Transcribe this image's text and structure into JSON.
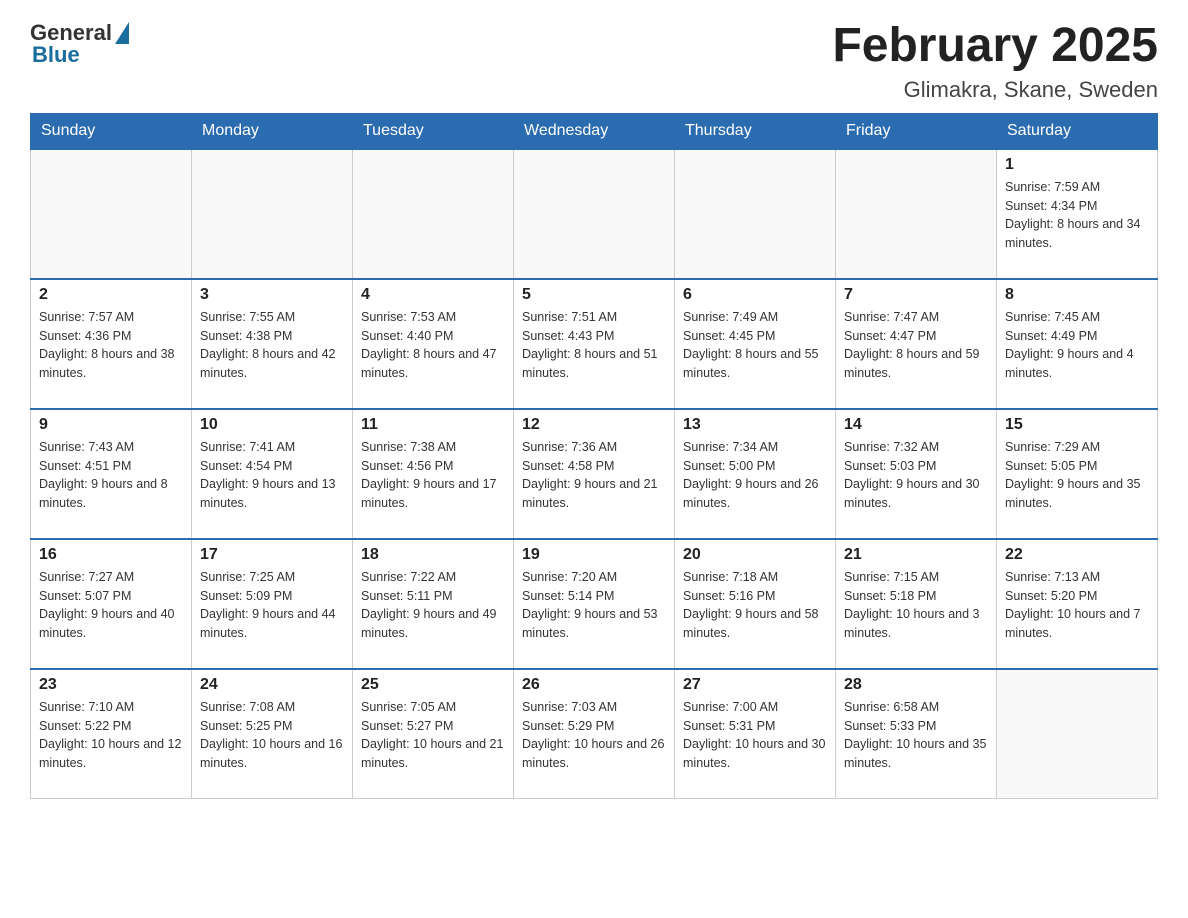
{
  "header": {
    "logo": {
      "general": "General",
      "blue": "Blue"
    },
    "title": "February 2025",
    "location": "Glimakra, Skane, Sweden"
  },
  "days_of_week": [
    "Sunday",
    "Monday",
    "Tuesday",
    "Wednesday",
    "Thursday",
    "Friday",
    "Saturday"
  ],
  "weeks": [
    [
      {
        "day": "",
        "sunrise": "",
        "sunset": "",
        "daylight": ""
      },
      {
        "day": "",
        "sunrise": "",
        "sunset": "",
        "daylight": ""
      },
      {
        "day": "",
        "sunrise": "",
        "sunset": "",
        "daylight": ""
      },
      {
        "day": "",
        "sunrise": "",
        "sunset": "",
        "daylight": ""
      },
      {
        "day": "",
        "sunrise": "",
        "sunset": "",
        "daylight": ""
      },
      {
        "day": "",
        "sunrise": "",
        "sunset": "",
        "daylight": ""
      },
      {
        "day": "1",
        "sunrise": "Sunrise: 7:59 AM",
        "sunset": "Sunset: 4:34 PM",
        "daylight": "Daylight: 8 hours and 34 minutes."
      }
    ],
    [
      {
        "day": "2",
        "sunrise": "Sunrise: 7:57 AM",
        "sunset": "Sunset: 4:36 PM",
        "daylight": "Daylight: 8 hours and 38 minutes."
      },
      {
        "day": "3",
        "sunrise": "Sunrise: 7:55 AM",
        "sunset": "Sunset: 4:38 PM",
        "daylight": "Daylight: 8 hours and 42 minutes."
      },
      {
        "day": "4",
        "sunrise": "Sunrise: 7:53 AM",
        "sunset": "Sunset: 4:40 PM",
        "daylight": "Daylight: 8 hours and 47 minutes."
      },
      {
        "day": "5",
        "sunrise": "Sunrise: 7:51 AM",
        "sunset": "Sunset: 4:43 PM",
        "daylight": "Daylight: 8 hours and 51 minutes."
      },
      {
        "day": "6",
        "sunrise": "Sunrise: 7:49 AM",
        "sunset": "Sunset: 4:45 PM",
        "daylight": "Daylight: 8 hours and 55 minutes."
      },
      {
        "day": "7",
        "sunrise": "Sunrise: 7:47 AM",
        "sunset": "Sunset: 4:47 PM",
        "daylight": "Daylight: 8 hours and 59 minutes."
      },
      {
        "day": "8",
        "sunrise": "Sunrise: 7:45 AM",
        "sunset": "Sunset: 4:49 PM",
        "daylight": "Daylight: 9 hours and 4 minutes."
      }
    ],
    [
      {
        "day": "9",
        "sunrise": "Sunrise: 7:43 AM",
        "sunset": "Sunset: 4:51 PM",
        "daylight": "Daylight: 9 hours and 8 minutes."
      },
      {
        "day": "10",
        "sunrise": "Sunrise: 7:41 AM",
        "sunset": "Sunset: 4:54 PM",
        "daylight": "Daylight: 9 hours and 13 minutes."
      },
      {
        "day": "11",
        "sunrise": "Sunrise: 7:38 AM",
        "sunset": "Sunset: 4:56 PM",
        "daylight": "Daylight: 9 hours and 17 minutes."
      },
      {
        "day": "12",
        "sunrise": "Sunrise: 7:36 AM",
        "sunset": "Sunset: 4:58 PM",
        "daylight": "Daylight: 9 hours and 21 minutes."
      },
      {
        "day": "13",
        "sunrise": "Sunrise: 7:34 AM",
        "sunset": "Sunset: 5:00 PM",
        "daylight": "Daylight: 9 hours and 26 minutes."
      },
      {
        "day": "14",
        "sunrise": "Sunrise: 7:32 AM",
        "sunset": "Sunset: 5:03 PM",
        "daylight": "Daylight: 9 hours and 30 minutes."
      },
      {
        "day": "15",
        "sunrise": "Sunrise: 7:29 AM",
        "sunset": "Sunset: 5:05 PM",
        "daylight": "Daylight: 9 hours and 35 minutes."
      }
    ],
    [
      {
        "day": "16",
        "sunrise": "Sunrise: 7:27 AM",
        "sunset": "Sunset: 5:07 PM",
        "daylight": "Daylight: 9 hours and 40 minutes."
      },
      {
        "day": "17",
        "sunrise": "Sunrise: 7:25 AM",
        "sunset": "Sunset: 5:09 PM",
        "daylight": "Daylight: 9 hours and 44 minutes."
      },
      {
        "day": "18",
        "sunrise": "Sunrise: 7:22 AM",
        "sunset": "Sunset: 5:11 PM",
        "daylight": "Daylight: 9 hours and 49 minutes."
      },
      {
        "day": "19",
        "sunrise": "Sunrise: 7:20 AM",
        "sunset": "Sunset: 5:14 PM",
        "daylight": "Daylight: 9 hours and 53 minutes."
      },
      {
        "day": "20",
        "sunrise": "Sunrise: 7:18 AM",
        "sunset": "Sunset: 5:16 PM",
        "daylight": "Daylight: 9 hours and 58 minutes."
      },
      {
        "day": "21",
        "sunrise": "Sunrise: 7:15 AM",
        "sunset": "Sunset: 5:18 PM",
        "daylight": "Daylight: 10 hours and 3 minutes."
      },
      {
        "day": "22",
        "sunrise": "Sunrise: 7:13 AM",
        "sunset": "Sunset: 5:20 PM",
        "daylight": "Daylight: 10 hours and 7 minutes."
      }
    ],
    [
      {
        "day": "23",
        "sunrise": "Sunrise: 7:10 AM",
        "sunset": "Sunset: 5:22 PM",
        "daylight": "Daylight: 10 hours and 12 minutes."
      },
      {
        "day": "24",
        "sunrise": "Sunrise: 7:08 AM",
        "sunset": "Sunset: 5:25 PM",
        "daylight": "Daylight: 10 hours and 16 minutes."
      },
      {
        "day": "25",
        "sunrise": "Sunrise: 7:05 AM",
        "sunset": "Sunset: 5:27 PM",
        "daylight": "Daylight: 10 hours and 21 minutes."
      },
      {
        "day": "26",
        "sunrise": "Sunrise: 7:03 AM",
        "sunset": "Sunset: 5:29 PM",
        "daylight": "Daylight: 10 hours and 26 minutes."
      },
      {
        "day": "27",
        "sunrise": "Sunrise: 7:00 AM",
        "sunset": "Sunset: 5:31 PM",
        "daylight": "Daylight: 10 hours and 30 minutes."
      },
      {
        "day": "28",
        "sunrise": "Sunrise: 6:58 AM",
        "sunset": "Sunset: 5:33 PM",
        "daylight": "Daylight: 10 hours and 35 minutes."
      },
      {
        "day": "",
        "sunrise": "",
        "sunset": "",
        "daylight": ""
      }
    ]
  ]
}
